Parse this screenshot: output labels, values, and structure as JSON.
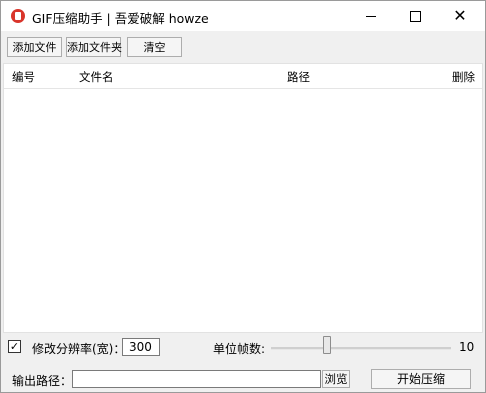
{
  "window": {
    "title": "GIF压缩助手 | 吾爱破解 howze",
    "minimize_icon": "minimize-icon",
    "maximize_icon": "maximize-icon",
    "close_icon": "close-icon"
  },
  "toolbar": {
    "add_file": "添加文件",
    "add_folder": "添加文件夹",
    "clear": "清空"
  },
  "list": {
    "columns": [
      "编号",
      "文件名",
      "路径",
      "删除"
    ],
    "rows": []
  },
  "settings": {
    "resize_checked": true,
    "checkbox_glyph": "✓",
    "resize_label": "修改分辨率(宽)：",
    "resize_width": "300",
    "fps_label": "单位帧数:",
    "fps_value": "10",
    "output_label": "输出路径：",
    "output_path": "",
    "browse_label": "浏览",
    "start_label": "开始压缩"
  },
  "colors": {
    "icon_red": "#d9352b"
  }
}
